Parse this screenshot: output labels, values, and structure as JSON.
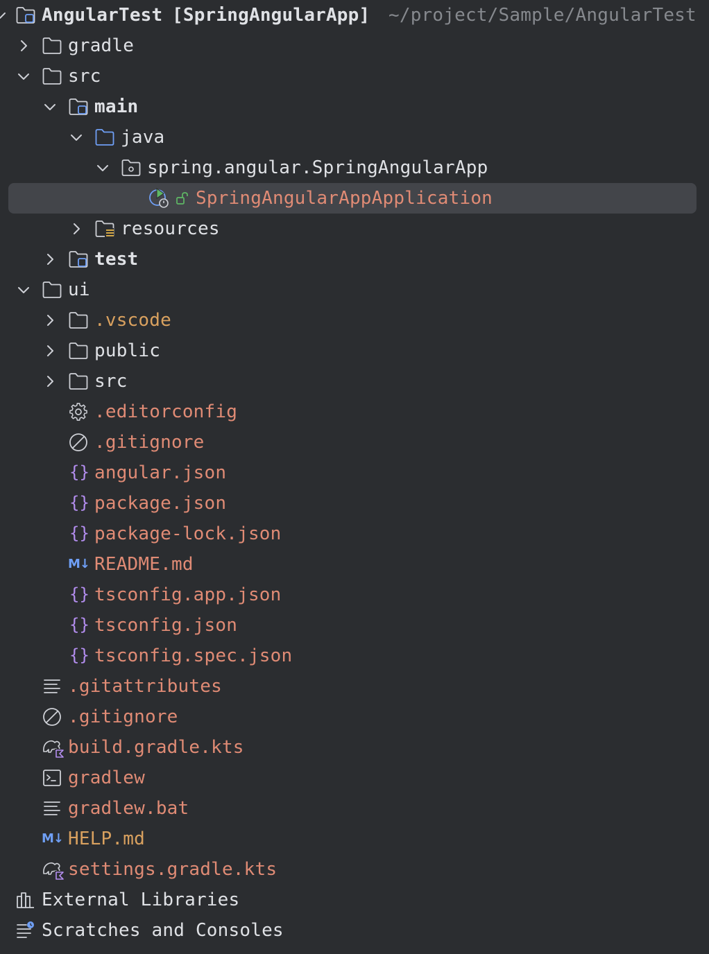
{
  "tree": {
    "root": {
      "name": "AngularTest",
      "module": "[SpringAngularApp]",
      "path": "~/project/Sample/AngularTest"
    },
    "gradle": "gradle",
    "src": "src",
    "main": "main",
    "java": "java",
    "package": "spring.angular.SpringAngularApp",
    "app_class": "SpringAngularAppApplication",
    "resources": "resources",
    "test": "test",
    "ui": "ui",
    "ui_vscode": ".vscode",
    "ui_public": "public",
    "ui_src": "src",
    "ui_editorconfig": ".editorconfig",
    "ui_gitignore": ".gitignore",
    "ui_angular_json": "angular.json",
    "ui_package_json": "package.json",
    "ui_package_lock": "package-lock.json",
    "ui_readme": "README.md",
    "ui_tsconfig_app": "tsconfig.app.json",
    "ui_tsconfig": "tsconfig.json",
    "ui_tsconfig_spec": "tsconfig.spec.json",
    "gitattributes": ".gitattributes",
    "gitignore": ".gitignore",
    "build_gradle": "build.gradle.kts",
    "gradlew": "gradlew",
    "gradlew_bat": "gradlew.bat",
    "help_md": "HELP.md",
    "settings_gradle": "settings.gradle.kts",
    "external_libraries": "External Libraries",
    "scratches": "Scratches and Consoles"
  },
  "icons": {
    "markdown": "M↓",
    "json": "{}"
  },
  "colors": {
    "background": "#2b2d30",
    "selection": "#43454a",
    "text": "#dfe1e5",
    "untracked_file": "#e08b75",
    "ignored_dir": "#d9a15f",
    "path_dim": "#86898e",
    "source_folder": "#6f9ff5",
    "json_icon": "#b48ef0",
    "run_icon": "#5fb865"
  }
}
